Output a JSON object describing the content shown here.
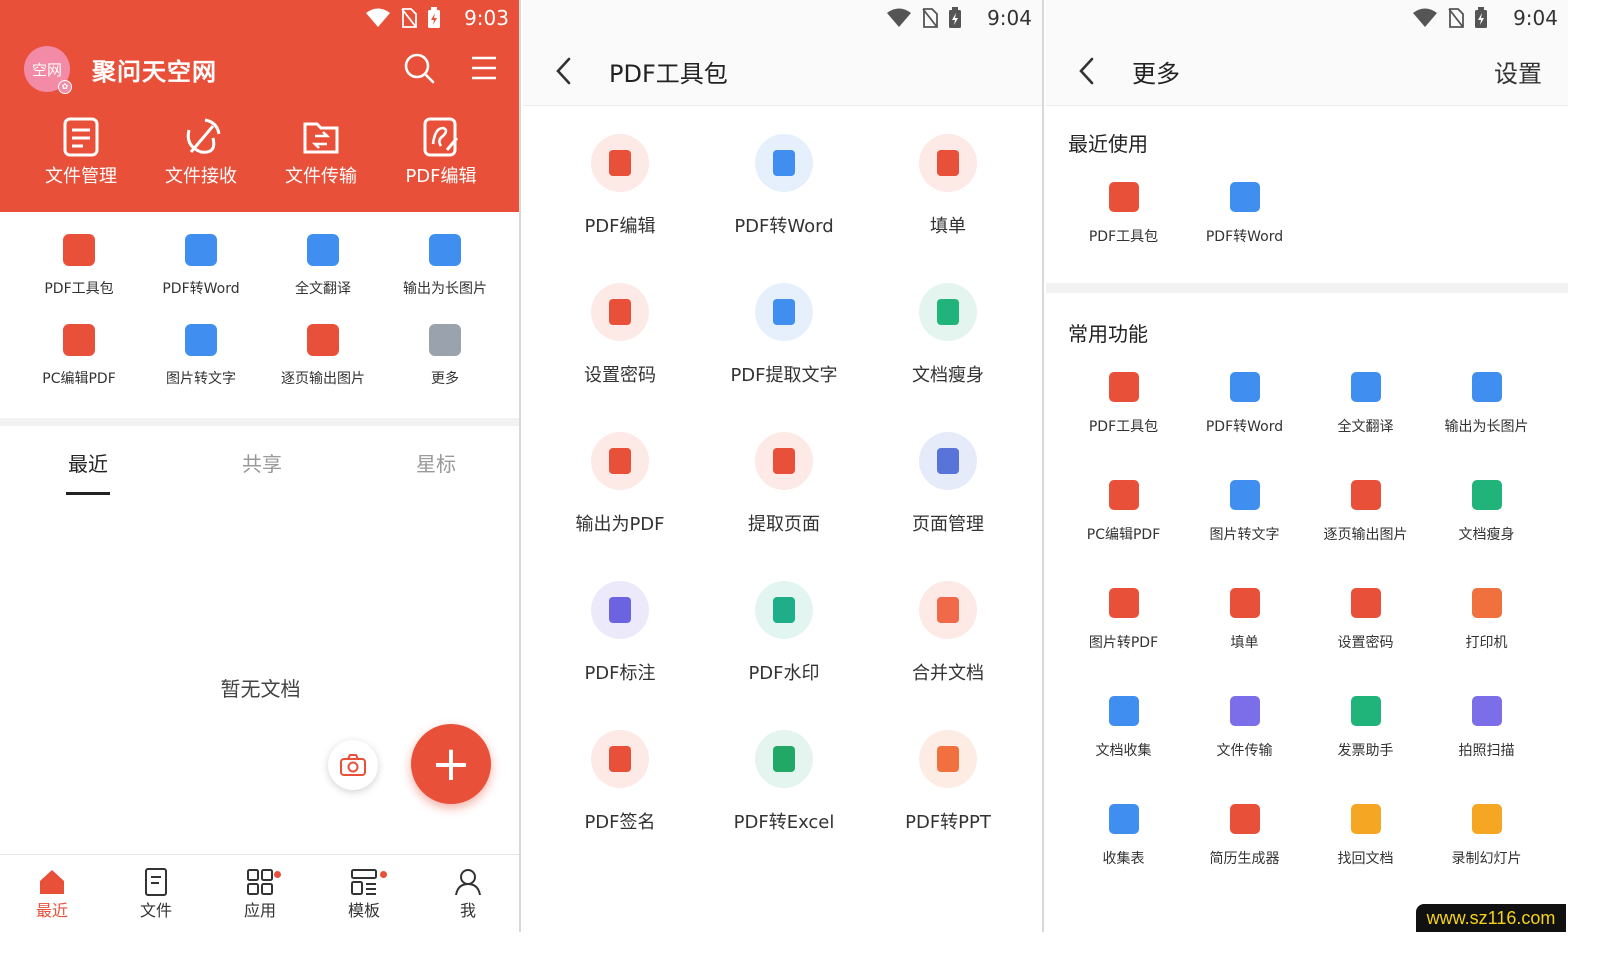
{
  "watermark": "www.sz116.com",
  "panel1": {
    "status_time": "9:03",
    "avatar_text": "空网",
    "brand_name": "聚问天空网",
    "top_tools": [
      {
        "label": "文件管理",
        "icon": "file-manage-icon"
      },
      {
        "label": "文件接收",
        "icon": "satellite-icon"
      },
      {
        "label": "文件传输",
        "icon": "folder-transfer-icon"
      },
      {
        "label": "PDF编辑",
        "icon": "pdf-edit-icon"
      }
    ],
    "apps": [
      {
        "label": "PDF工具包",
        "color": "#e8503a"
      },
      {
        "label": "PDF转Word",
        "color": "#3f8ef0"
      },
      {
        "label": "全文翻译",
        "color": "#3f8ef0"
      },
      {
        "label": "输出为长图片",
        "color": "#3f8ef0"
      },
      {
        "label": "PC编辑PDF",
        "color": "#e8503a"
      },
      {
        "label": "图片转文字",
        "color": "#3f8ef0"
      },
      {
        "label": "逐页输出图片",
        "color": "#e8503a"
      },
      {
        "label": "更多",
        "color": "#9aa3ad"
      }
    ],
    "tabs": [
      "最近",
      "共享",
      "星标"
    ],
    "empty_text": "暂无文档",
    "fab_symbol": "+",
    "bottom_nav": [
      {
        "label": "最近",
        "icon": "home-icon",
        "active": true
      },
      {
        "label": "文件",
        "icon": "document-icon"
      },
      {
        "label": "应用",
        "icon": "apps-grid-icon"
      },
      {
        "label": "模板",
        "icon": "template-icon"
      },
      {
        "label": "我",
        "icon": "user-icon"
      }
    ]
  },
  "panel2": {
    "status_time": "9:04",
    "title": "PDF工具包",
    "tools": [
      {
        "label": "PDF编辑",
        "bg": "#fde9e6",
        "fg": "#e8503a"
      },
      {
        "label": "PDF转Word",
        "bg": "#e6f0fd",
        "fg": "#3f8ef0"
      },
      {
        "label": "填单",
        "bg": "#fde9e6",
        "fg": "#e8503a"
      },
      {
        "label": "设置密码",
        "bg": "#fde9e6",
        "fg": "#e8503a"
      },
      {
        "label": "PDF提取文字",
        "bg": "#e6f0fd",
        "fg": "#3f8ef0"
      },
      {
        "label": "文档瘦身",
        "bg": "#e3f5ee",
        "fg": "#20b37a"
      },
      {
        "label": "输出为PDF",
        "bg": "#fde9e6",
        "fg": "#e8503a"
      },
      {
        "label": "提取页面",
        "bg": "#fde9e6",
        "fg": "#e8503a"
      },
      {
        "label": "页面管理",
        "bg": "#e6ebfa",
        "fg": "#5874d8"
      },
      {
        "label": "PDF标注",
        "bg": "#ece9fb",
        "fg": "#6b63e0"
      },
      {
        "label": "PDF水印",
        "bg": "#e2f5f1",
        "fg": "#1fae8a"
      },
      {
        "label": "合并文档",
        "bg": "#fde9e6",
        "fg": "#f06a4a"
      },
      {
        "label": "PDF签名",
        "bg": "#fde9e6",
        "fg": "#e8503a"
      },
      {
        "label": "PDF转Excel",
        "bg": "#e3f5ee",
        "fg": "#22a866"
      },
      {
        "label": "PDF转PPT",
        "bg": "#fdece3",
        "fg": "#f0713e"
      }
    ]
  },
  "panel3": {
    "status_time": "9:04",
    "title": "更多",
    "settings_label": "设置",
    "recent_title": "最近使用",
    "recent": [
      {
        "label": "PDF工具包",
        "color": "#e8503a"
      },
      {
        "label": "PDF转Word",
        "color": "#3f8ef0"
      }
    ],
    "common_title": "常用功能",
    "common": [
      {
        "label": "PDF工具包",
        "color": "#e8503a"
      },
      {
        "label": "PDF转Word",
        "color": "#3f8ef0"
      },
      {
        "label": "全文翻译",
        "color": "#3f8ef0"
      },
      {
        "label": "输出为长图片",
        "color": "#3f8ef0"
      },
      {
        "label": "PC编辑PDF",
        "color": "#e8503a"
      },
      {
        "label": "图片转文字",
        "color": "#3f8ef0"
      },
      {
        "label": "逐页输出图片",
        "color": "#e8503a"
      },
      {
        "label": "文档瘦身",
        "color": "#20b37a"
      },
      {
        "label": "图片转PDF",
        "color": "#e8503a"
      },
      {
        "label": "填单",
        "color": "#e8503a"
      },
      {
        "label": "设置密码",
        "color": "#e8503a"
      },
      {
        "label": "打印机",
        "color": "#f0713e"
      },
      {
        "label": "文档收集",
        "color": "#3f8ef0"
      },
      {
        "label": "文件传输",
        "color": "#7b6ee8"
      },
      {
        "label": "发票助手",
        "color": "#20b37a"
      },
      {
        "label": "拍照扫描",
        "color": "#7b6ee8"
      },
      {
        "label": "收集表",
        "color": "#3f8ef0"
      },
      {
        "label": "简历生成器",
        "color": "#e8503a"
      },
      {
        "label": "找回文档",
        "color": "#f5a623"
      },
      {
        "label": "录制幻灯片",
        "color": "#f5a623"
      }
    ]
  }
}
